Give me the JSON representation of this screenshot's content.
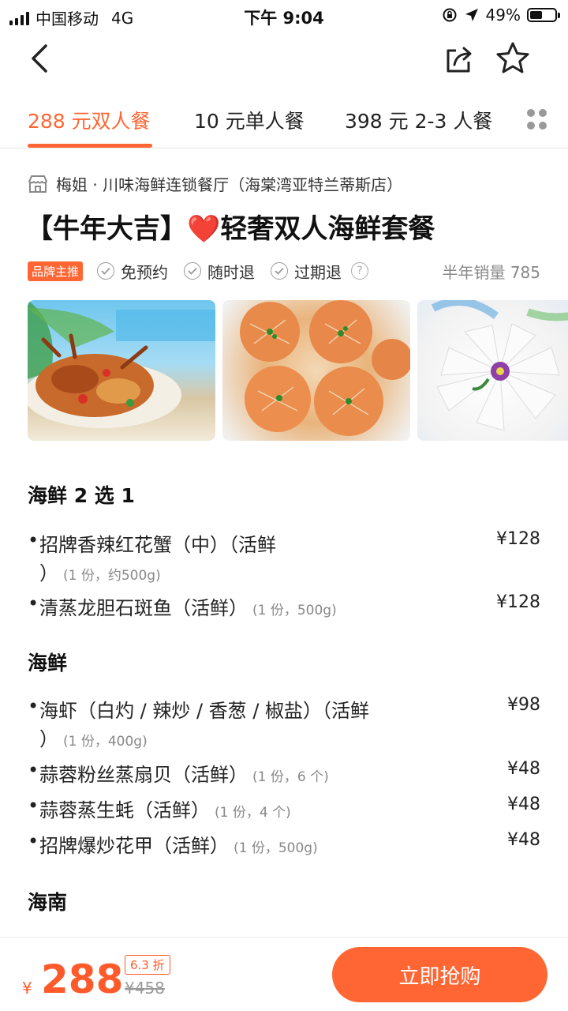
{
  "status_bar": {
    "carrier": "中国移动",
    "network": "4G",
    "time": "下午 9:04",
    "battery_percent": "49%",
    "battery_level": 0.49
  },
  "tabs": [
    {
      "label": "288 元双人餐",
      "active": true
    },
    {
      "label": "10 元单人餐",
      "active": false
    },
    {
      "label": "398 元 2-3 人餐",
      "active": false
    }
  ],
  "store": {
    "name": "梅姐 · 川味海鲜连锁餐厅（海棠湾亚特兰蒂斯店）"
  },
  "deal": {
    "title_prefix": "【牛年大吉】",
    "heart": "❤️",
    "title_suffix": "轻奢双人海鲜套餐",
    "brand_badge": "品牌主推",
    "tags": [
      "免预约",
      "随时退",
      "过期退"
    ],
    "sales": "半年销量 785"
  },
  "menu": {
    "sections": [
      {
        "title": "海鲜 2 选 1",
        "items": [
          {
            "name": "招牌香辣红花蟹（中）（活鲜",
            "cont": "）",
            "qty": "(1 份，约500g)",
            "price": "¥128"
          },
          {
            "name": "清蒸龙胆石斑鱼（活鲜）",
            "qty": "(1 份，500g)",
            "price": "¥128"
          }
        ]
      },
      {
        "title": "海鲜",
        "items": [
          {
            "name": "海虾（白灼 / 辣炒 / 香葱 / 椒盐）（活鲜",
            "cont": "）",
            "qty": "(1 份，400g)",
            "price": "¥98"
          },
          {
            "name": "蒜蓉粉丝蒸扇贝（活鲜）",
            "qty": "(1 份，6 个)",
            "price": "¥48"
          },
          {
            "name": "蒜蓉蒸生蚝（活鲜）",
            "qty": "(1 份，4 个)",
            "price": "¥48"
          },
          {
            "name": "招牌爆炒花甲（活鲜）",
            "qty": "(1 份，500g)",
            "price": "¥48"
          }
        ]
      },
      {
        "title": "海南",
        "items": []
      }
    ]
  },
  "bottom": {
    "currency": "¥",
    "price": "288",
    "discount": "6.3 折",
    "original_price": "¥458",
    "buy_label": "立即抢购"
  },
  "icons": {
    "back": "chevron-left-icon",
    "share": "share-icon",
    "favorite": "star-icon",
    "more_tabs": "grid-dots-icon",
    "store": "storefront-icon",
    "check": "check-circle-icon",
    "help": "question-circle-icon"
  },
  "colors": {
    "accent": "#ff6633",
    "price": "#ff5a2c"
  }
}
